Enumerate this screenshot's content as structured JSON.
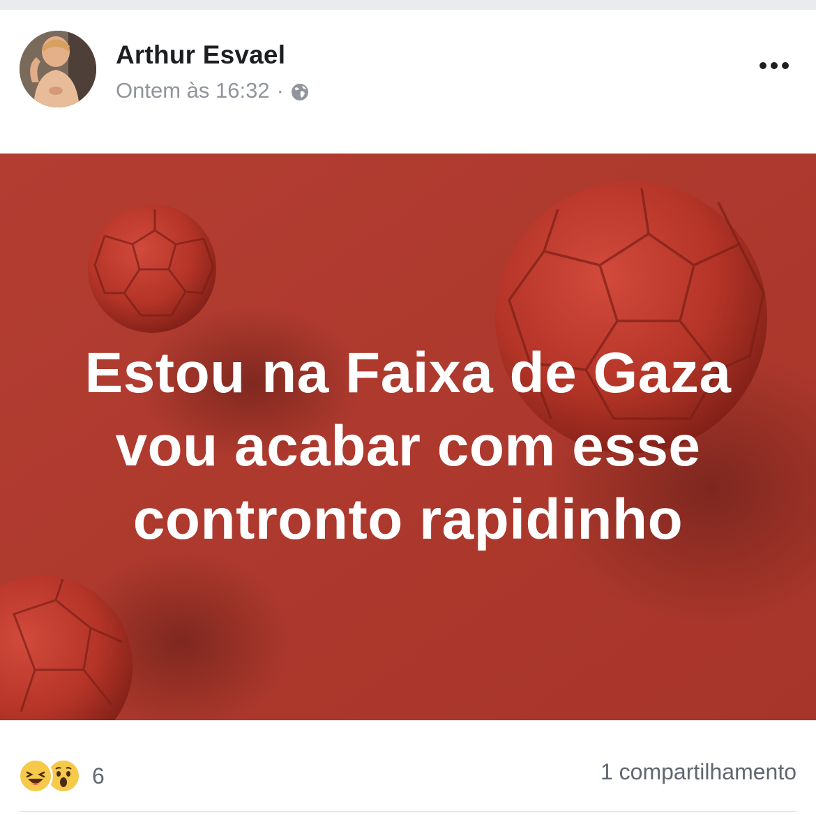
{
  "post": {
    "author": "Arthur Esvael",
    "timestamp": "Ontem às 16:32",
    "separator": "·",
    "privacy_icon": "globe-icon",
    "more_icon": "more-options-icon",
    "text_lines": [
      "Estou na Faixa de Gaza",
      "vou acabar com esse",
      "contronto rapidinho"
    ],
    "background_color": "#ad392e",
    "text_color": "#ffffff"
  },
  "footer": {
    "reaction_icons": [
      "haha-emoji-icon",
      "wow-emoji-icon"
    ],
    "reaction_count": "6",
    "shares": "1 compartilhamento"
  }
}
